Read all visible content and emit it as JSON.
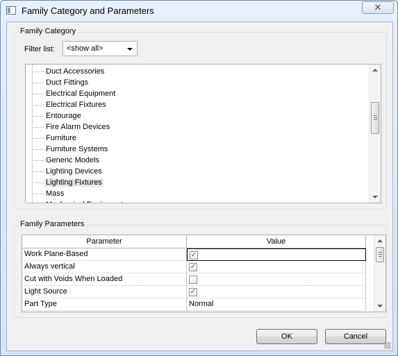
{
  "window": {
    "title": "Family Category and Parameters"
  },
  "family_category": {
    "group_label": "Family Category",
    "filter_label": "Filter list:",
    "filter_value": "<show all>",
    "items": [
      {
        "label": "Duct Accessories",
        "selected": false
      },
      {
        "label": "Duct Fittings",
        "selected": false
      },
      {
        "label": "Electrical Equipment",
        "selected": false
      },
      {
        "label": "Electrical Fixtures",
        "selected": false
      },
      {
        "label": "Entourage",
        "selected": false
      },
      {
        "label": "Fire Alarm Devices",
        "selected": false
      },
      {
        "label": "Furniture",
        "selected": false
      },
      {
        "label": "Furniture Systems",
        "selected": false
      },
      {
        "label": "Generic Models",
        "selected": false
      },
      {
        "label": "Lighting Devices",
        "selected": false
      },
      {
        "label": "Lighting Fixtures",
        "selected": true
      },
      {
        "label": "Mass",
        "selected": false
      },
      {
        "label": "Mechanical Equipment",
        "selected": false
      }
    ]
  },
  "family_parameters": {
    "group_label": "Family Parameters",
    "columns": [
      "Parameter",
      "Value"
    ],
    "rows": [
      {
        "parameter": "Work Plane-Based",
        "type": "checkbox",
        "checked": true
      },
      {
        "parameter": "Always vertical",
        "type": "checkbox",
        "checked": true
      },
      {
        "parameter": "Cut with Voids When Loaded",
        "type": "checkbox",
        "checked": false
      },
      {
        "parameter": "Light Source",
        "type": "checkbox",
        "checked": true
      },
      {
        "parameter": "Part Type",
        "type": "text",
        "value": "Normal"
      }
    ]
  },
  "buttons": {
    "ok": "OK",
    "cancel": "Cancel"
  },
  "icons": {
    "close": "close-icon",
    "checkmark": "checkmark-icon"
  }
}
